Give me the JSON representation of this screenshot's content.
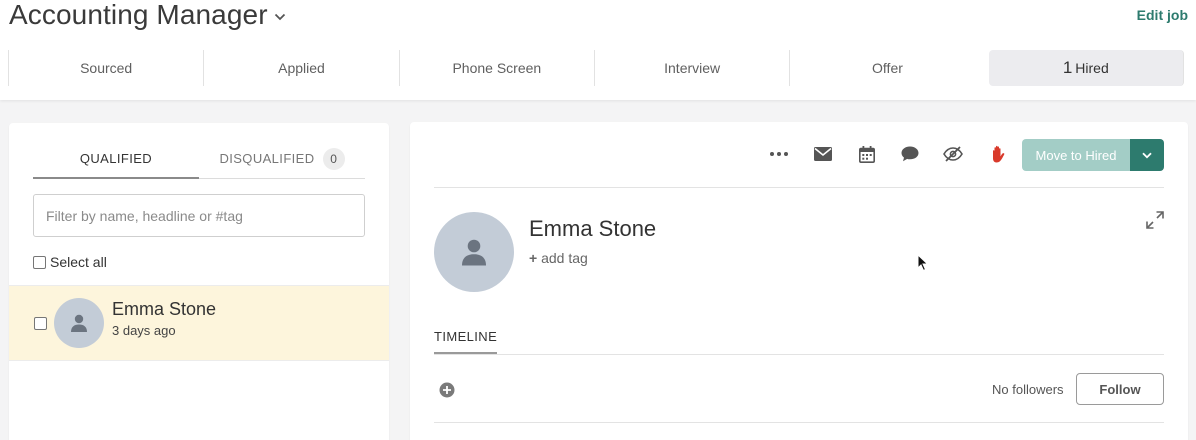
{
  "header": {
    "job_title": "Accounting Manager",
    "edit_job_label": "Edit job"
  },
  "stages": [
    {
      "label": "Sourced",
      "count": null,
      "active": false
    },
    {
      "label": "Applied",
      "count": null,
      "active": false
    },
    {
      "label": "Phone Screen",
      "count": null,
      "active": false
    },
    {
      "label": "Interview",
      "count": null,
      "active": false
    },
    {
      "label": "Offer",
      "count": null,
      "active": false
    },
    {
      "label": "Hired",
      "count": "1",
      "active": true
    }
  ],
  "left_panel": {
    "tabs": {
      "qualified": "QUALIFIED",
      "disqualified": "DISQUALIFIED",
      "disqualified_count": "0"
    },
    "filter_placeholder": "Filter by name, headline or #tag",
    "select_all_label": "Select all",
    "candidates": [
      {
        "name": "Emma Stone",
        "time": "3 days ago"
      }
    ]
  },
  "right_panel": {
    "toolbar": {
      "icons": [
        "more-icon",
        "email-icon",
        "calendar-icon",
        "comment-icon",
        "hide-icon",
        "stop-hand-icon"
      ],
      "move_button_label": "Move to Hired"
    },
    "profile": {
      "name": "Emma Stone",
      "add_tag_label": "add tag"
    },
    "timeline_tab": "TIMELINE",
    "followers_text": "No followers",
    "follow_button_label": "Follow"
  },
  "colors": {
    "brand": "#2d7b6e",
    "move_button_disabled": "#a3cdc6",
    "selected_row": "#fdf5dc",
    "avatar_bg": "#c3ccd7",
    "stop_hand": "#d93a2b"
  }
}
